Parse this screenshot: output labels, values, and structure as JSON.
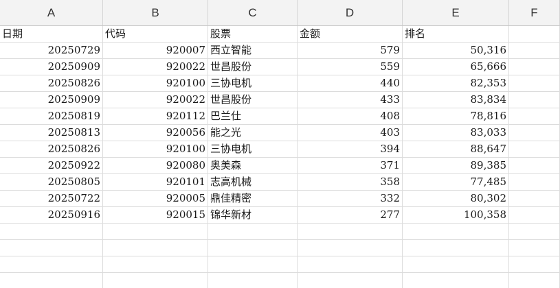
{
  "columns": [
    "A",
    "B",
    "C",
    "D",
    "E",
    "F"
  ],
  "header": [
    "日期",
    "代码",
    "股票",
    "金额",
    "排名",
    ""
  ],
  "rows": [
    [
      "20250729",
      "920007",
      "西立智能",
      "579",
      "50,316",
      ""
    ],
    [
      "20250909",
      "920022",
      "世昌股份",
      "559",
      "65,666",
      ""
    ],
    [
      "20250826",
      "920100",
      "三协电机",
      "440",
      "82,353",
      ""
    ],
    [
      "20250909",
      "920022",
      "世昌股份",
      "433",
      "83,834",
      ""
    ],
    [
      "20250819",
      "920112",
      "巴兰仕",
      "408",
      "78,816",
      ""
    ],
    [
      "20250813",
      "920056",
      "能之光",
      "403",
      "83,033",
      ""
    ],
    [
      "20250826",
      "920100",
      "三协电机",
      "394",
      "88,647",
      ""
    ],
    [
      "20250922",
      "920080",
      "奥美森",
      "371",
      "89,385",
      ""
    ],
    [
      "20250805",
      "920101",
      "志高机械",
      "358",
      "77,485",
      ""
    ],
    [
      "20250722",
      "920005",
      "鼎佳精密",
      "332",
      "80,302",
      ""
    ],
    [
      "20250916",
      "920015",
      "锦华新材",
      "277",
      "100,358",
      ""
    ],
    [
      "",
      "",
      "",
      "",
      "",
      ""
    ],
    [
      "",
      "",
      "",
      "",
      "",
      ""
    ],
    [
      "",
      "",
      "",
      "",
      "",
      ""
    ],
    [
      "",
      "",
      "",
      "",
      "",
      ""
    ]
  ]
}
